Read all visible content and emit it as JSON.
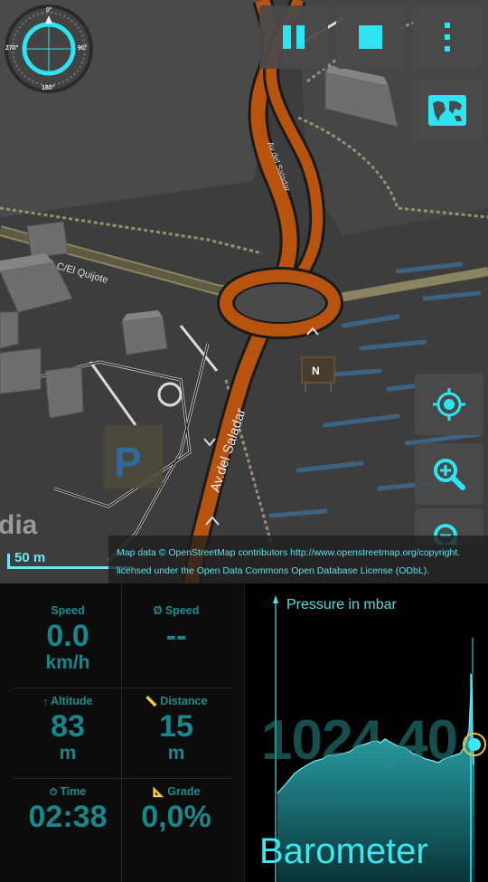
{
  "map": {
    "street_labels": [
      "C/El Quijote",
      "Av.del Saladar",
      "Av.del Saladar",
      "N"
    ],
    "place_label_fragment": "dia",
    "parking_label": "P",
    "scale_label": "50 m",
    "attribution_line1": "Map data © OpenStreetMap contributors http://www.openstreetmap.org/copyright.",
    "attribution_line2": "licensed under the Open Data Commons Open Database License (ODbL)."
  },
  "compass": {
    "north": "0°",
    "east": "90°",
    "south": "180°",
    "west": "270°"
  },
  "controls": {
    "pause_icon": "pause-icon",
    "stop_icon": "stop-icon",
    "menu_icon": "more-vertical-icon",
    "map_layers_icon": "world-map-icon",
    "locate_icon": "crosshair-icon",
    "zoom_in_icon": "zoom-in-icon",
    "zoom_out_icon": "zoom-out-icon"
  },
  "stats": {
    "speed": {
      "title": "Speed",
      "value": "0.0",
      "unit": "km/h"
    },
    "avg_speed": {
      "title": "Ø Speed",
      "value": "--"
    },
    "altitude": {
      "icon": "↑",
      "title": "Altitude",
      "value": "83",
      "unit": "m"
    },
    "distance": {
      "icon": "📏",
      "title": "Distance",
      "value": "15",
      "unit": "m"
    },
    "time": {
      "icon": "⏱",
      "title": "Time",
      "value": "02:38"
    },
    "grade": {
      "icon": "📐",
      "title": "Grade",
      "value": "0,0%"
    }
  },
  "barometer": {
    "chart_title": "Pressure in mbar",
    "current_value": "1024,40",
    "name": "Barometer"
  },
  "colors": {
    "accent": "#3ee6f0",
    "stat_text": "#17878c",
    "road_orange": "#b8530f"
  }
}
